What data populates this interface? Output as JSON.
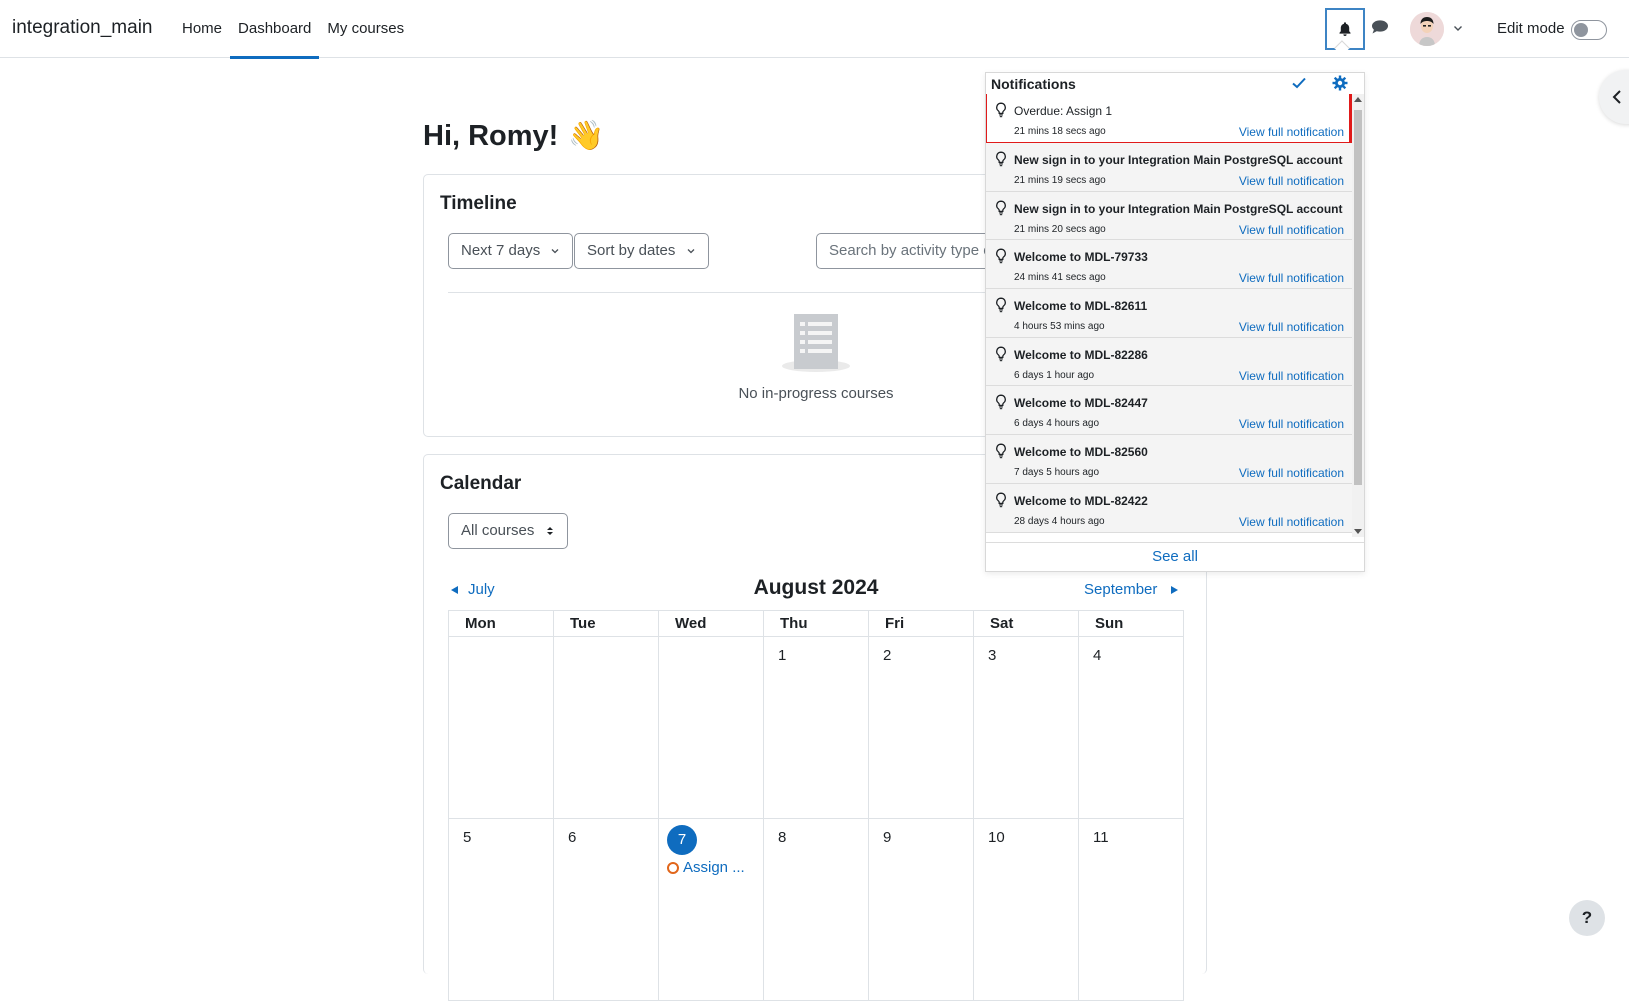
{
  "brand": "integration_main",
  "nav": {
    "items": [
      {
        "label": "Home",
        "active": false
      },
      {
        "label": "Dashboard",
        "active": true
      },
      {
        "label": "My courses",
        "active": false
      }
    ]
  },
  "header": {
    "edit_mode_label": "Edit mode",
    "edit_mode_on": false
  },
  "greeting": {
    "text": "Hi, Romy!",
    "emoji": "👋"
  },
  "timeline": {
    "title": "Timeline",
    "filter_label": "Next 7 days",
    "sort_label": "Sort by dates",
    "search_placeholder": "Search by activity type or name",
    "empty_text": "No in-progress courses"
  },
  "calendar": {
    "title": "Calendar",
    "course_filter": "All courses",
    "prev_month": "July",
    "next_month": "September",
    "month_title": "August 2024",
    "weekdays": [
      "Mon",
      "Tue",
      "Wed",
      "Thu",
      "Fri",
      "Sat",
      "Sun"
    ],
    "weeks": [
      [
        "",
        "",
        "",
        "1",
        "2",
        "3",
        "4"
      ],
      [
        "5",
        "6",
        "7",
        "8",
        "9",
        "10",
        "11"
      ]
    ],
    "today": "7",
    "event": {
      "day": "7",
      "label": "Assign ..."
    }
  },
  "notifications": {
    "title": "Notifications",
    "view_link_label": "View full notification",
    "see_all": "See all",
    "items": [
      {
        "subject": "Overdue: Assign 1",
        "time": "21 mins 18 secs ago",
        "read": true
      },
      {
        "subject": "New sign in to your Integration Main PostgreSQL account",
        "time": "21 mins 19 secs ago",
        "read": false
      },
      {
        "subject": "New sign in to your Integration Main PostgreSQL account",
        "time": "21 mins 20 secs ago",
        "read": false
      },
      {
        "subject": "Welcome to MDL-79733",
        "time": "24 mins 41 secs ago",
        "read": false
      },
      {
        "subject": "Welcome to MDL-82611",
        "time": "4 hours 53 mins ago",
        "read": false
      },
      {
        "subject": "Welcome to MDL-82286",
        "time": "6 days 1 hour ago",
        "read": false
      },
      {
        "subject": "Welcome to MDL-82447",
        "time": "6 days 4 hours ago",
        "read": false
      },
      {
        "subject": "Welcome to MDL-82560",
        "time": "7 days 5 hours ago",
        "read": false
      },
      {
        "subject": "Welcome to MDL-82422",
        "time": "28 days 4 hours ago",
        "read": false
      }
    ]
  },
  "help_label": "?",
  "colors": {
    "primary": "#0f6cbf",
    "highlight": "#e01a1a",
    "event_overdue": "#e1661b"
  }
}
